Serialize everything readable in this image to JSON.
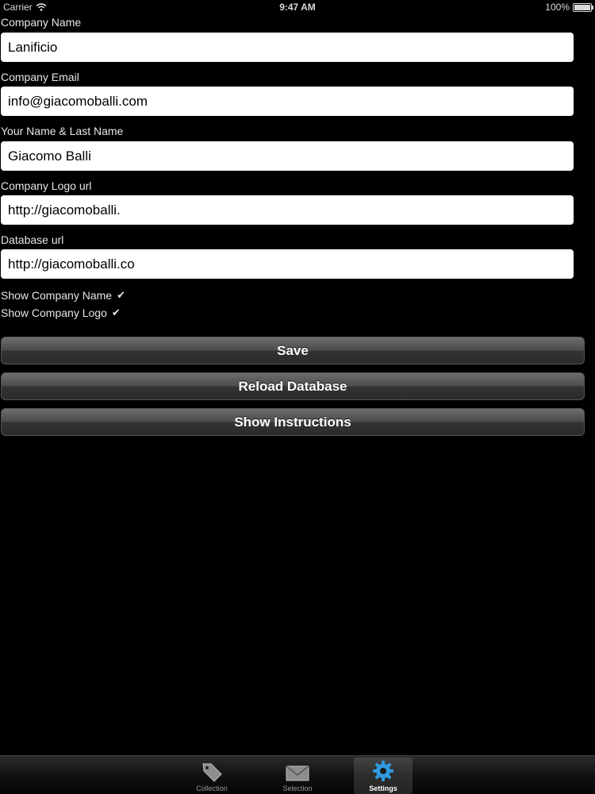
{
  "status_bar": {
    "carrier": "Carrier",
    "time": "9:47 AM",
    "battery": "100%"
  },
  "form": {
    "company_name": {
      "label": "Company Name",
      "value": "Lanificio"
    },
    "company_email": {
      "label": "Company Email",
      "value": "info@giacomoballi.com"
    },
    "your_name": {
      "label": "Your Name & Last Name",
      "value": "Giacomo Balli"
    },
    "logo_url": {
      "label": "Company Logo url",
      "value": "http://giacomoballi."
    },
    "database_url": {
      "label": "Database url",
      "value": "http://giacomoballi.co"
    },
    "show_company_name": {
      "label": "Show Company Name",
      "checked": true
    },
    "show_company_logo": {
      "label": "Show Company Logo",
      "checked": true
    }
  },
  "buttons": {
    "save": "Save",
    "reload_database": "Reload Database",
    "show_instructions": "Show Instructions"
  },
  "tab_bar": {
    "tabs": [
      {
        "label": "Collection",
        "icon": "tag-icon",
        "selected": false
      },
      {
        "label": "Selection",
        "icon": "envelope-icon",
        "selected": false
      },
      {
        "label": "Settings",
        "icon": "gear-icon",
        "selected": true
      }
    ]
  },
  "colors": {
    "background": "#000000",
    "accent_selected_tab": "#2f9be0"
  }
}
